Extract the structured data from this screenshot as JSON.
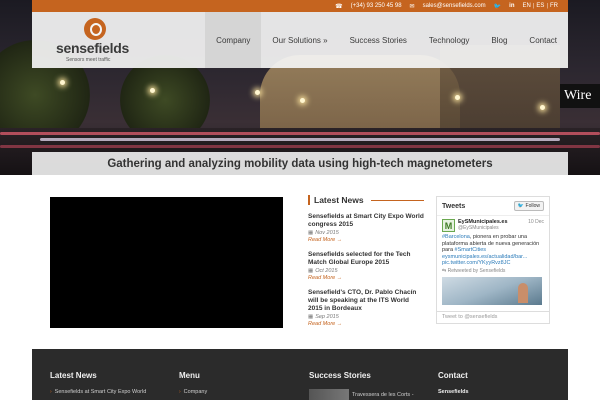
{
  "topbar": {
    "phone": "(+34) 93 250 45 98",
    "email": "sales@sensefields.com",
    "languages": [
      "EN",
      "ES",
      "FR"
    ],
    "accent": "#c5641f"
  },
  "brand": {
    "name": "sensefields",
    "tagline": "Sensors meet traffic"
  },
  "nav": [
    "Company",
    "Our Solutions »",
    "Success Stories",
    "Technology",
    "Blog",
    "Contact"
  ],
  "hero": {
    "slide_caption": "Wire"
  },
  "tagline": "Gathering and analyzing mobility data using high-tech magnetometers",
  "news": {
    "heading": "Latest News",
    "items": [
      {
        "title": "Sensefields at Smart City Expo World congress 2015",
        "date": "Nov 2015",
        "more": "Read More →"
      },
      {
        "title": "Sensefields selected for the Tech Match Global Europe 2015",
        "date": "Oct 2015",
        "more": "Read More →"
      },
      {
        "title": "Sensefield's CTO, Dr. Pablo Chacín will be speaking at the ITS World 2015 in Bordeaux",
        "date": "Sep 2015",
        "more": "Read More →"
      }
    ]
  },
  "tweets": {
    "title": "Tweets",
    "follow_label": "Follow",
    "user_name": "EySMunicipales.es",
    "user_handle": "@EySMunicipales",
    "date": "10 Dec",
    "avatar_letter": "M",
    "text_part1": "#Barcelona",
    "text_part2": ", pionera en probar una plataforma abierta de nueva generación para ",
    "text_part3": "#SmartCities eysmunicipales.es/actualidad/bar... pic.twitter.com/YKyyRvz8JC",
    "retweeted_by": "Retweeted by Sensefields",
    "input_placeholder": "Tweet to @sensefields"
  },
  "footer": {
    "news_heading": "Latest News",
    "news_first": "Sensefields at Smart City Expo World",
    "menu_heading": "Menu",
    "menu_first": "Company",
    "stories_heading": "Success Stories",
    "stories_first": "Travessera de les Corts -",
    "contact_heading": "Contact",
    "contact_first": "Sensefields"
  }
}
